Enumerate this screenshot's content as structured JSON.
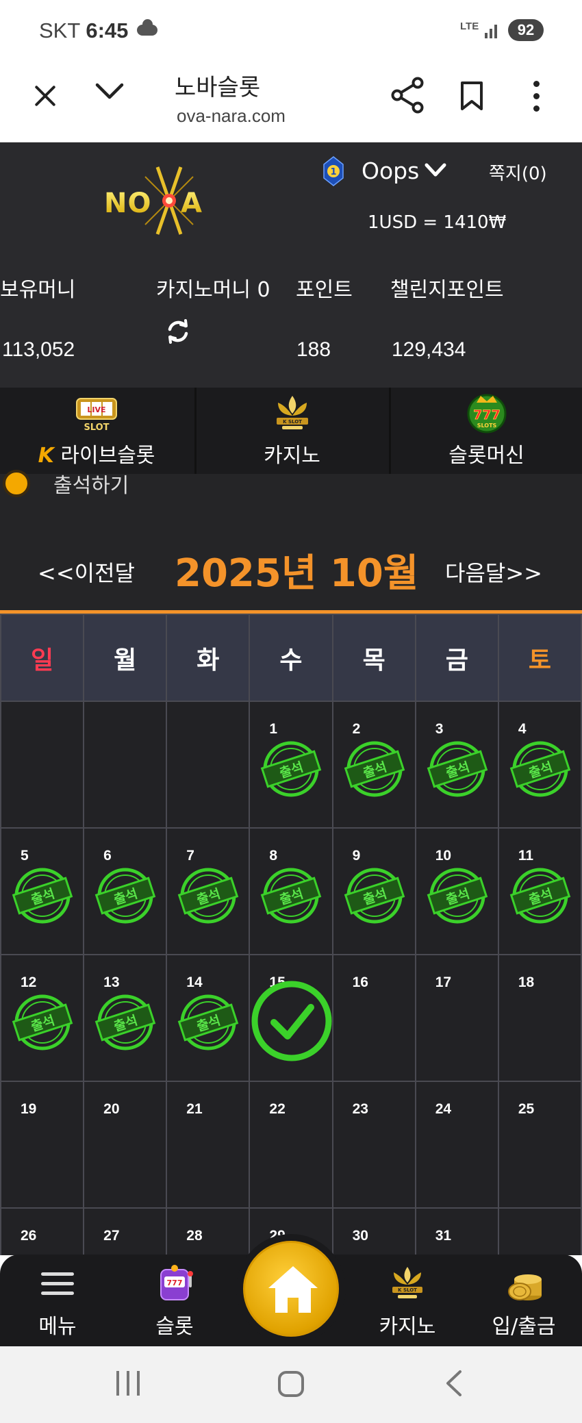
{
  "status_bar": {
    "carrier": "SKT",
    "time": "6:45",
    "network": "LTE",
    "battery": "92"
  },
  "browser": {
    "title": "노바슬롯",
    "url": "ova-nara.com"
  },
  "header": {
    "user_level": "1",
    "username": "Oops",
    "messages": "쪽지(0)",
    "exchange_rate": "1USD = 1410₩"
  },
  "balances": {
    "held_money_label": "보유머니",
    "held_money_value": "113,052",
    "casino_money_label": "카지노머니 0",
    "points_label": "포인트",
    "points_value": "188",
    "challenge_points_label": "챌린지포인트",
    "challenge_points_value": "129,434"
  },
  "game_nav": [
    {
      "label": "라이브슬롯",
      "icon": "live-slot-icon"
    },
    {
      "label": "카지노",
      "icon": "k-slot-icon"
    },
    {
      "label": "슬롯머신",
      "icon": "777-slots-icon"
    }
  ],
  "checkin": {
    "label": "출석하기"
  },
  "month_nav": {
    "prev": "<<이전달",
    "title": "2025년 10월",
    "next": "다음달>>"
  },
  "calendar": {
    "weekdays": [
      "일",
      "월",
      "화",
      "수",
      "목",
      "금",
      "토"
    ],
    "stamp_text": "출석",
    "weeks": [
      [
        "",
        "",
        "",
        "1",
        "2",
        "3",
        "4"
      ],
      [
        "5",
        "6",
        "7",
        "8",
        "9",
        "10",
        "11"
      ],
      [
        "12",
        "13",
        "14",
        "15",
        "16",
        "17",
        "18"
      ],
      [
        "19",
        "20",
        "21",
        "22",
        "23",
        "24",
        "25"
      ],
      [
        "26",
        "27",
        "28",
        "29",
        "30",
        "31",
        ""
      ]
    ],
    "attended_days": [
      1,
      2,
      3,
      4,
      5,
      6,
      7,
      8,
      9,
      10,
      11,
      12,
      13,
      14
    ],
    "today": 15
  },
  "bottom_nav": {
    "menu": "메뉴",
    "slot": "슬롯",
    "casino": "카지노",
    "deposit": "입/출금"
  },
  "colors": {
    "accent": "#f4932a",
    "stamp_green": "#3bd12a",
    "sunday": "#ff3b52"
  }
}
